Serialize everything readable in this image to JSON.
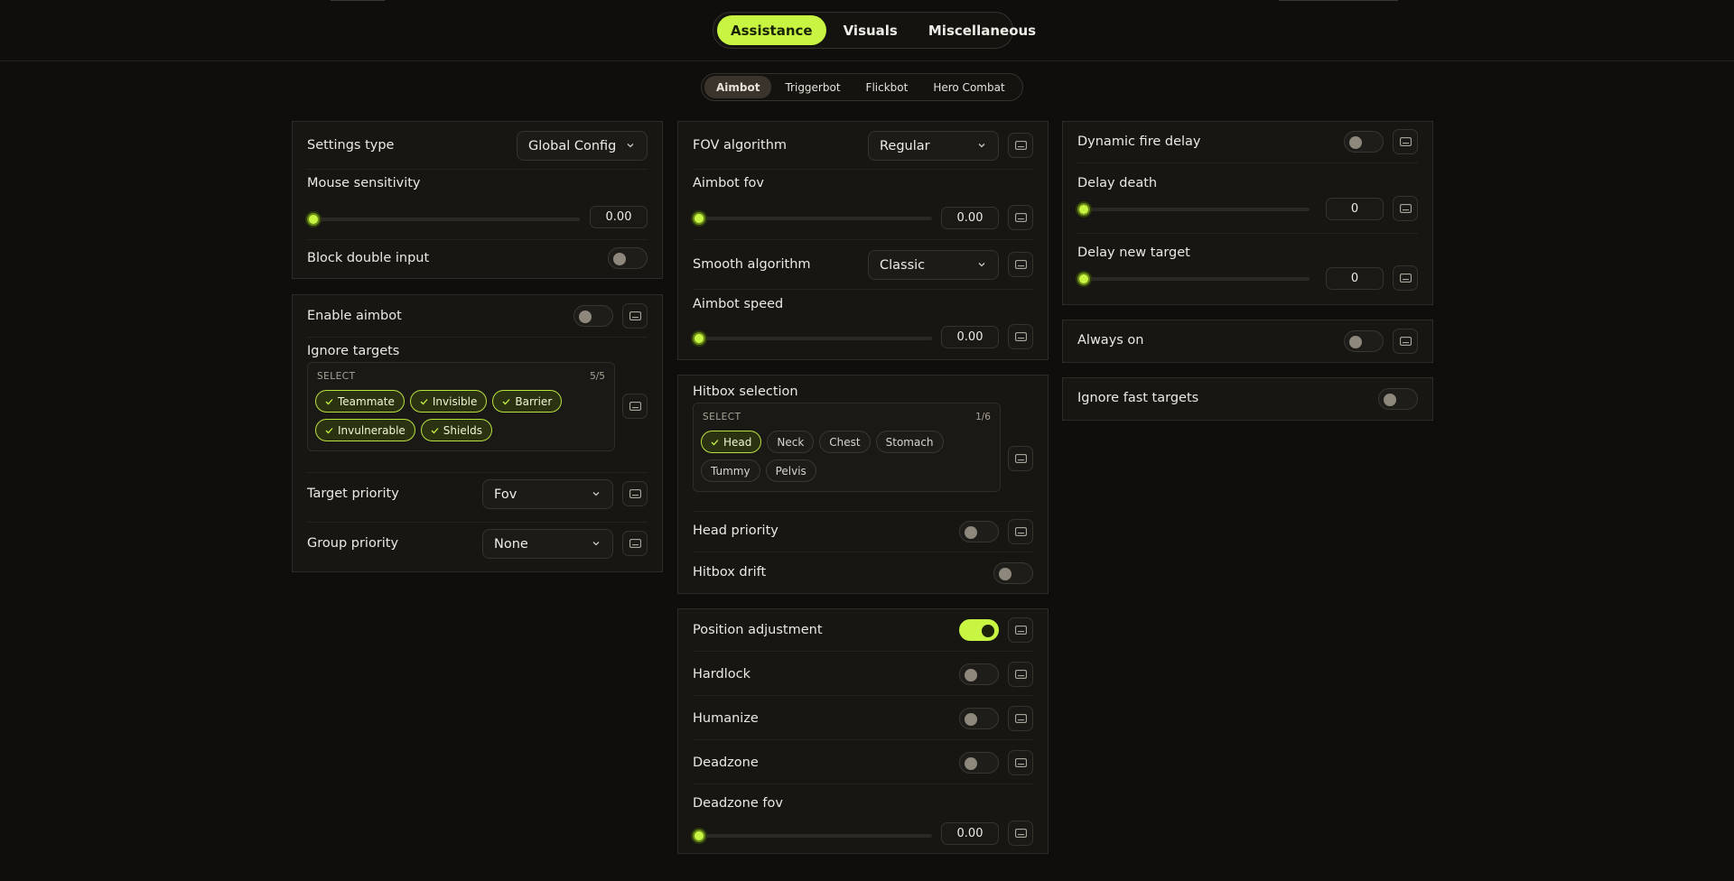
{
  "main_tabs": [
    {
      "label": "Assistance",
      "active": true
    },
    {
      "label": "Visuals",
      "active": false
    },
    {
      "label": "Miscellaneous",
      "active": false
    }
  ],
  "sub_tabs": [
    {
      "label": "Aimbot",
      "active": true
    },
    {
      "label": "Triggerbot",
      "active": false
    },
    {
      "label": "Flickbot",
      "active": false
    },
    {
      "label": "Hero Combat",
      "active": false
    }
  ],
  "accent_color": "#c8f542",
  "left": {
    "settings_type": {
      "label": "Settings type",
      "value": "Global Config"
    },
    "mouse_sensitivity": {
      "label": "Mouse sensitivity",
      "value": "0.00",
      "fraction": 0
    },
    "block_double_input": {
      "label": "Block double input",
      "on": false
    },
    "enable_aimbot": {
      "label": "Enable aimbot",
      "on": false
    },
    "ignore_targets": {
      "label": "Ignore targets",
      "select_label": "SELECT",
      "count": "5/5",
      "options": [
        {
          "label": "Teammate",
          "selected": true
        },
        {
          "label": "Invisible",
          "selected": true
        },
        {
          "label": "Barrier",
          "selected": true
        },
        {
          "label": "Invulnerable",
          "selected": true
        },
        {
          "label": "Shields",
          "selected": true
        }
      ]
    },
    "target_priority": {
      "label": "Target priority",
      "value": "Fov"
    },
    "group_priority": {
      "label": "Group priority",
      "value": "None"
    }
  },
  "middle": {
    "fov_algorithm": {
      "label": "FOV algorithm",
      "value": "Regular"
    },
    "aimbot_fov": {
      "label": "Aimbot fov",
      "value": "0.00",
      "fraction": 0
    },
    "smooth_algorithm": {
      "label": "Smooth algorithm",
      "value": "Classic"
    },
    "aimbot_speed": {
      "label": "Aimbot speed",
      "value": "0.00",
      "fraction": 0
    },
    "hitbox_selection": {
      "label": "Hitbox selection",
      "select_label": "SELECT",
      "count": "1/6",
      "options": [
        {
          "label": "Head",
          "selected": true
        },
        {
          "label": "Neck",
          "selected": false
        },
        {
          "label": "Chest",
          "selected": false
        },
        {
          "label": "Stomach",
          "selected": false
        },
        {
          "label": "Tummy",
          "selected": false
        },
        {
          "label": "Pelvis",
          "selected": false
        }
      ]
    },
    "head_priority": {
      "label": "Head priority",
      "on": false
    },
    "hitbox_drift": {
      "label": "Hitbox drift",
      "on": false
    },
    "position_adjustment": {
      "label": "Position adjustment",
      "on": true
    },
    "hardlock": {
      "label": "Hardlock",
      "on": false
    },
    "humanize": {
      "label": "Humanize",
      "on": false
    },
    "deadzone": {
      "label": "Deadzone",
      "on": false
    },
    "deadzone_fov": {
      "label": "Deadzone fov",
      "value": "0.00",
      "fraction": 0
    }
  },
  "right": {
    "dynamic_fire_delay": {
      "label": "Dynamic fire delay",
      "on": false
    },
    "delay_death": {
      "label": "Delay death",
      "value": "0",
      "fraction": 0
    },
    "delay_new_target": {
      "label": "Delay new target",
      "value": "0",
      "fraction": 0
    },
    "always_on": {
      "label": "Always on",
      "on": false
    },
    "ignore_fast_targets": {
      "label": "Ignore fast targets",
      "on": false
    }
  }
}
